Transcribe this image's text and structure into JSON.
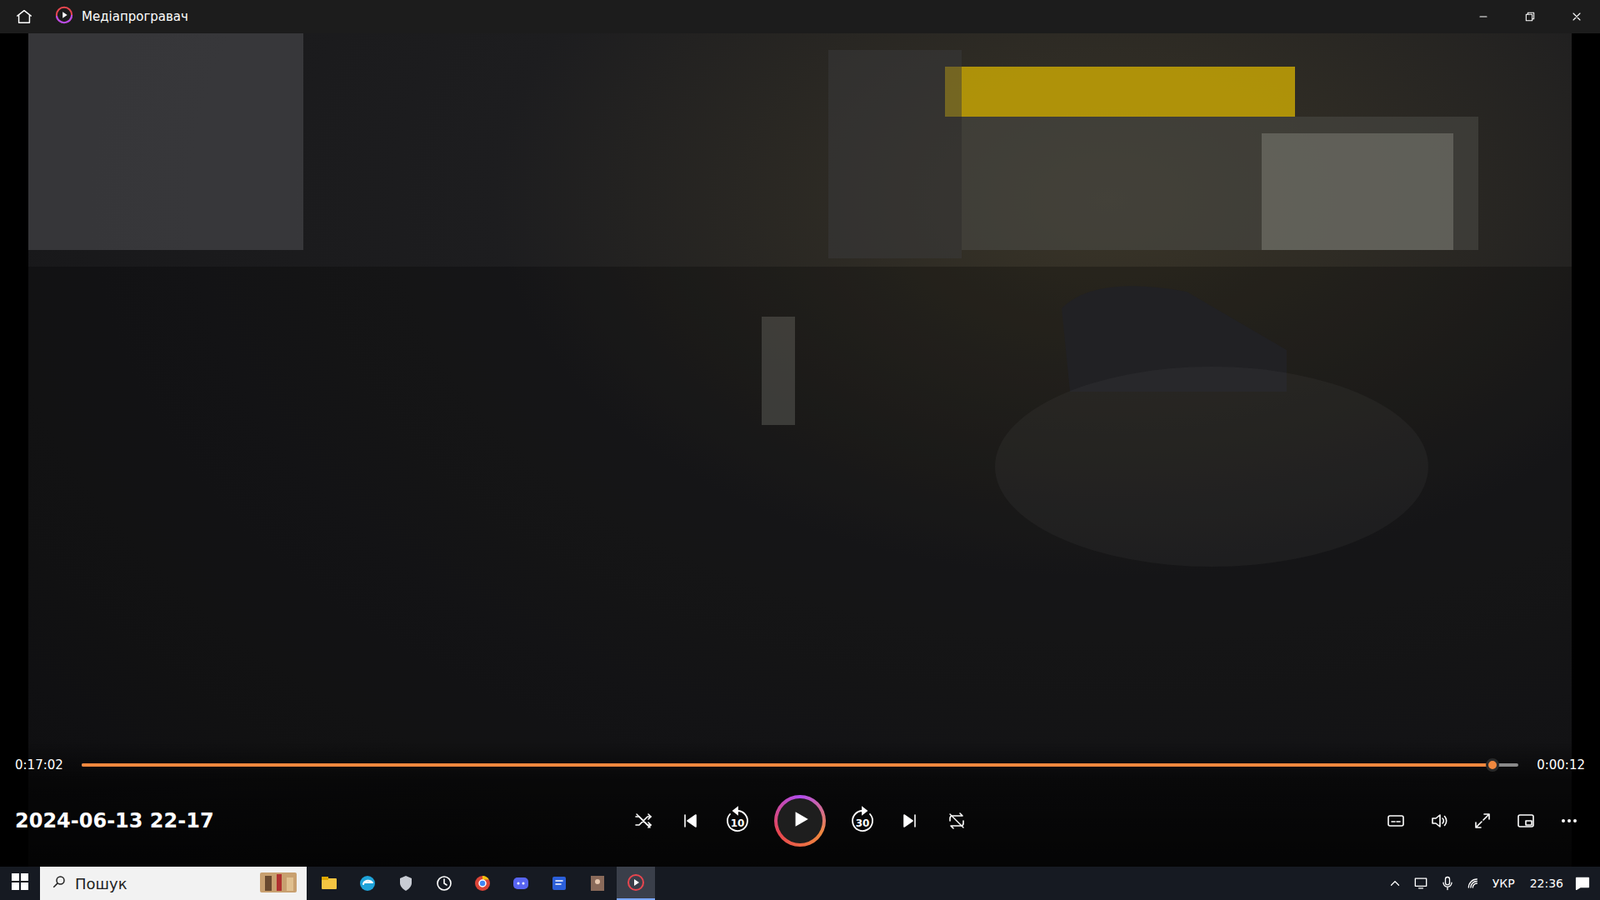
{
  "window": {
    "title": "Медіапрогравач"
  },
  "player": {
    "media_title": "2024-06-13 22-17",
    "elapsed": "0:17:02",
    "remaining": "0:00:12",
    "progress": {
      "level": 0.982
    },
    "playing": false,
    "skip_back": "10",
    "skip_forward": "30"
  },
  "taskbar": {
    "search": {
      "placeholder": "Пошук"
    },
    "apps": [
      {
        "active": false
      },
      {
        "active": false
      },
      {
        "active": false
      },
      {
        "active": false
      },
      {
        "active": false
      },
      {
        "active": false
      },
      {
        "active": false
      },
      {
        "active": false
      },
      {
        "active": true
      }
    ],
    "language": "УКР",
    "time": "22:36"
  }
}
